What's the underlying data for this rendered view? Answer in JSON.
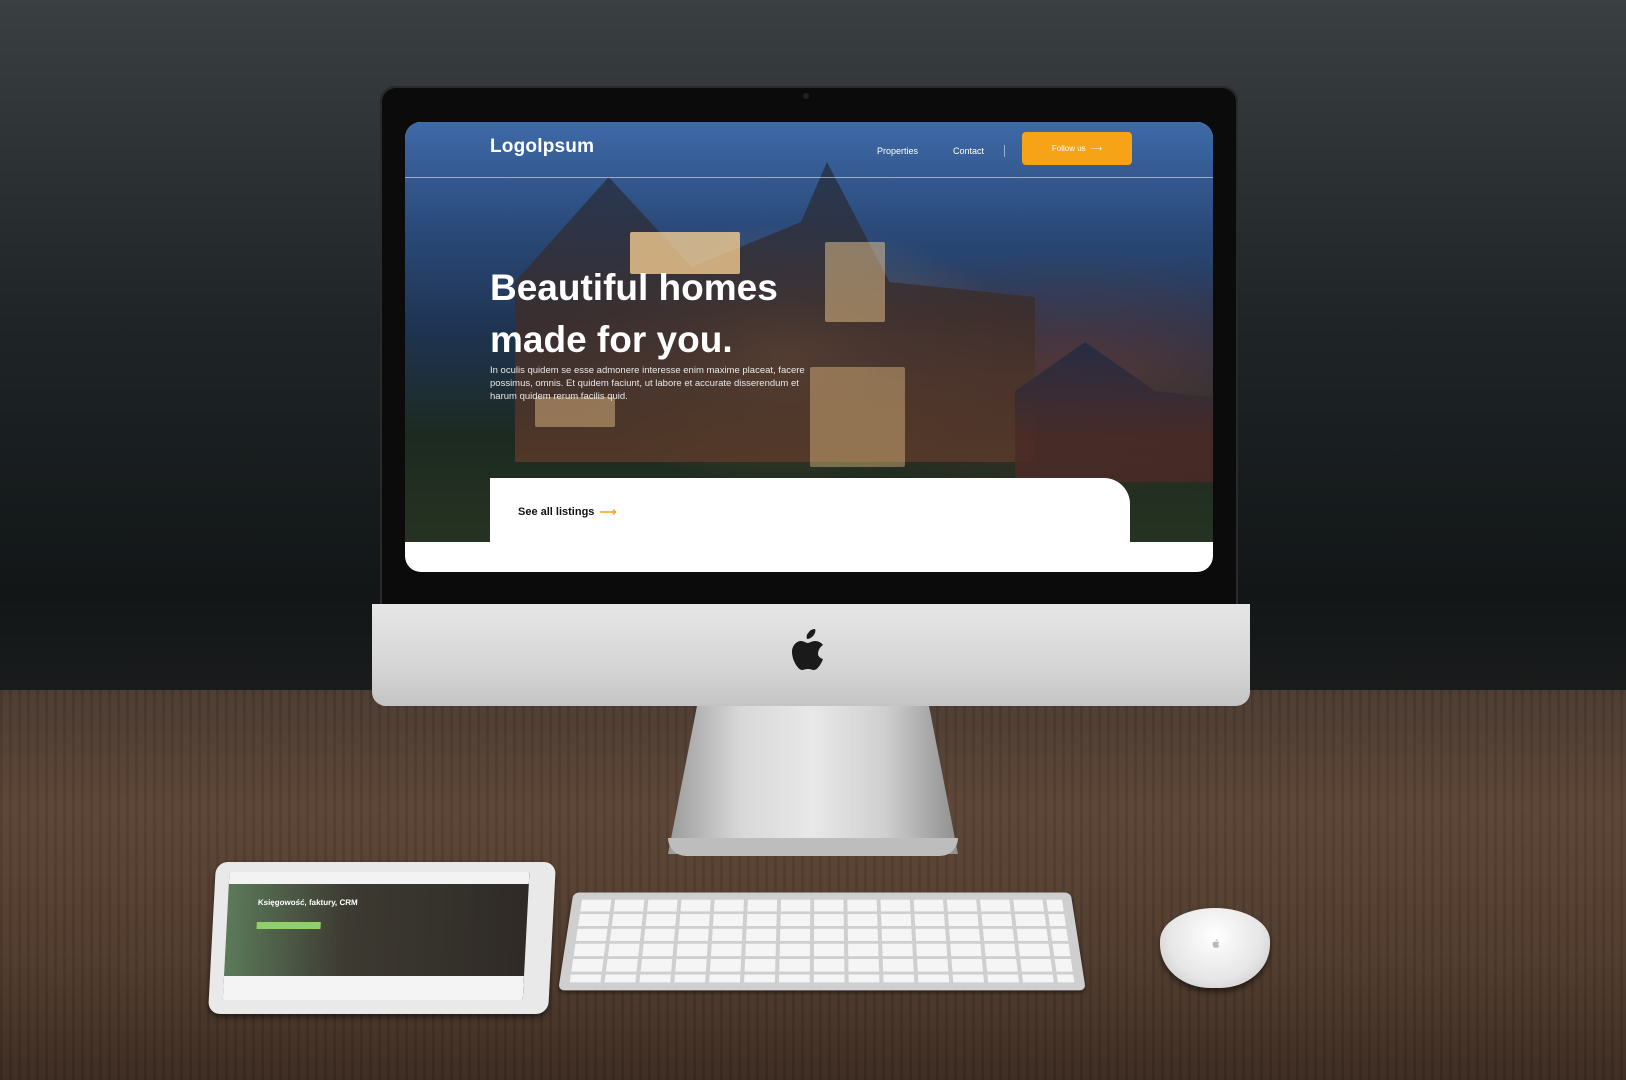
{
  "website": {
    "logo": "Logolpsum",
    "nav": {
      "properties": "Properties",
      "contact": "Contact",
      "follow": "Follow us",
      "follow_arrow": "⟶"
    },
    "hero": {
      "headline_line1": "Beautiful homes",
      "headline_line2": "made for you.",
      "body": "In oculis quidem se esse admonere interesse enim maxime placeat, facere possimus, omnis. Et quidem faciunt, ut labore et accurate disserendum et harum quidem rerum facilis quid."
    },
    "card": {
      "listings_label": "See all listings",
      "arrow": "⟶"
    },
    "colors": {
      "accent": "#f7a317"
    }
  },
  "ipad": {
    "headline": "Księgowość, faktury, CRM"
  }
}
